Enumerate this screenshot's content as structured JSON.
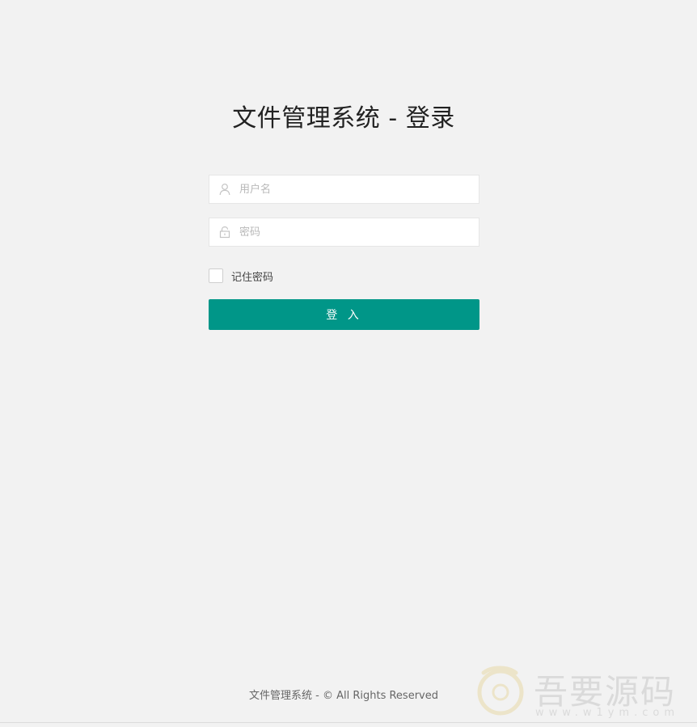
{
  "page": {
    "title": "文件管理系统 - 登录"
  },
  "form": {
    "username": {
      "placeholder": "用户名",
      "value": "",
      "icon": "user-icon"
    },
    "password": {
      "placeholder": "密码",
      "value": "",
      "icon": "lock-icon"
    },
    "remember": {
      "label": "记住密码",
      "checked": false
    },
    "submit_label": "登 入"
  },
  "footer": {
    "text": "文件管理系统 - © All Rights Reserved"
  },
  "watermark": {
    "name": "吾要源码",
    "url": "www.w1ym.com"
  },
  "colors": {
    "background": "#f2f2f2",
    "accent": "#009688",
    "input_border": "#e6e6e6"
  }
}
